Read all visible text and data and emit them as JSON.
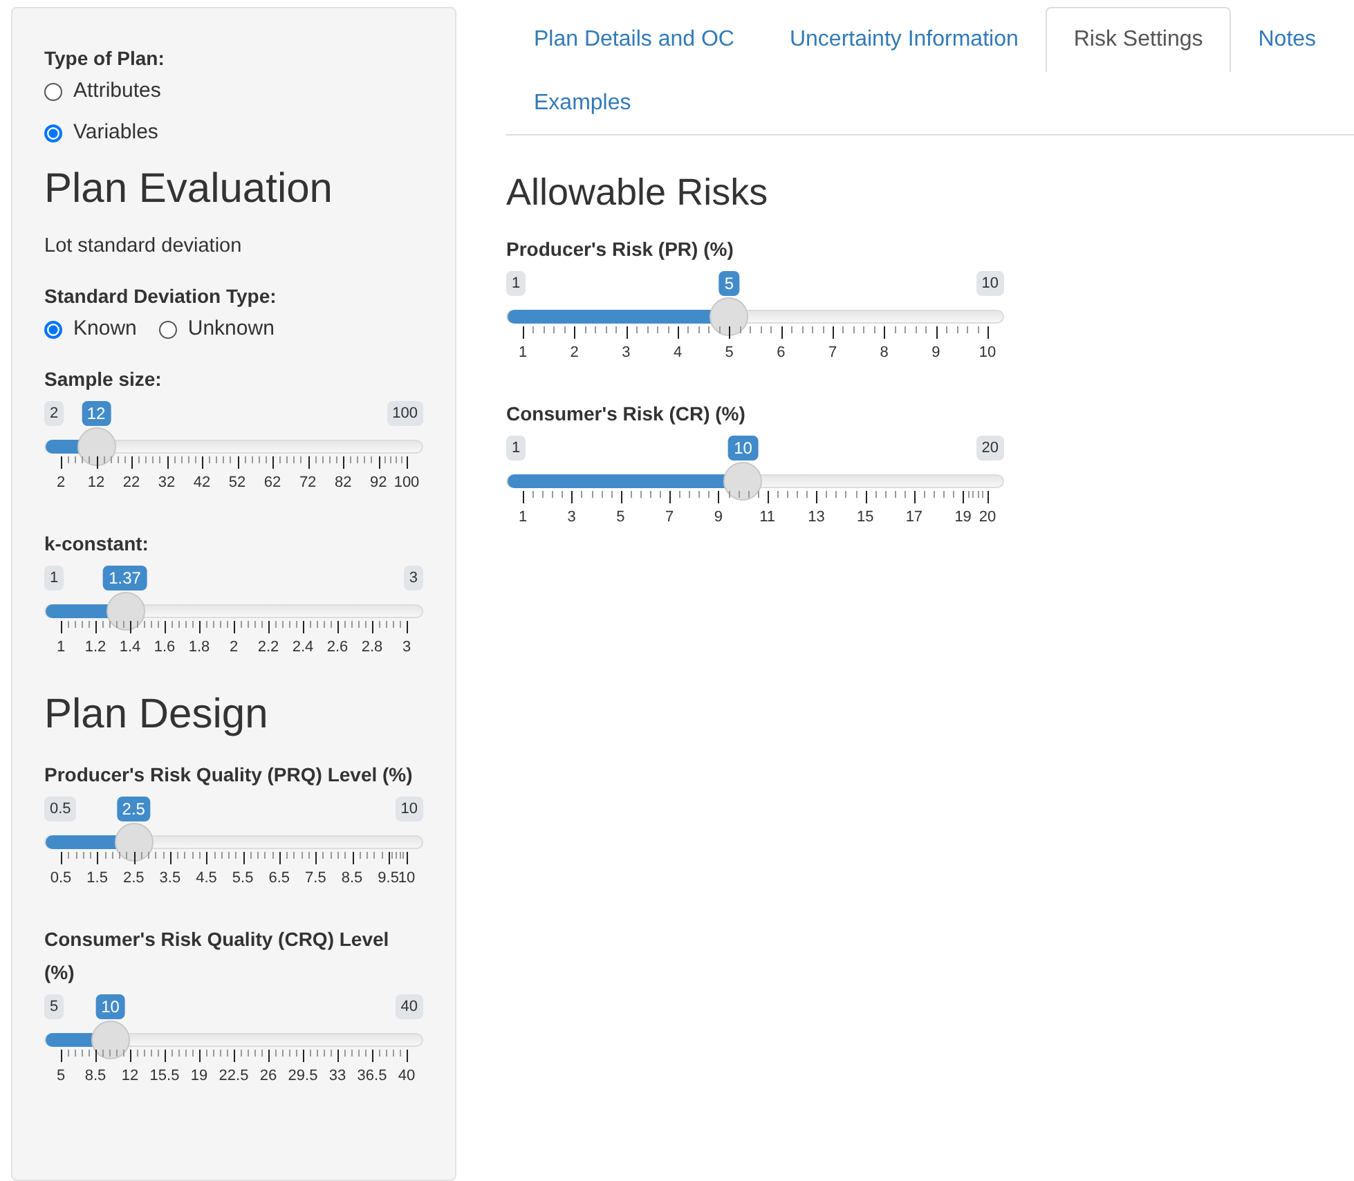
{
  "sidebar": {
    "items": [
      {
        "kind": "radio_stacked",
        "label": "Type of Plan:",
        "options": [
          {
            "label": "Attributes",
            "selected": false
          },
          {
            "label": "Variables",
            "selected": true
          }
        ]
      },
      {
        "kind": "heading",
        "text": "Plan Evaluation"
      },
      {
        "kind": "text",
        "text": "Lot standard deviation"
      },
      {
        "kind": "radio_inline",
        "label": "Standard Deviation Type:",
        "options": [
          {
            "label": "Known",
            "selected": true
          },
          {
            "label": "Unknown",
            "selected": false
          }
        ]
      },
      {
        "kind": "slider",
        "label": "Sample size:",
        "min": "2",
        "max": "100",
        "value": "12",
        "level": 0.102,
        "ticks": [
          "2",
          "12",
          "22",
          "32",
          "42",
          "52",
          "62",
          "72",
          "82",
          "92",
          "100"
        ]
      },
      {
        "kind": "slider",
        "label": "k-constant:",
        "min": "1",
        "max": "3",
        "value": "1.37",
        "level": 0.185,
        "ticks": [
          "1",
          "1.2",
          "1.4",
          "1.6",
          "1.8",
          "2",
          "2.2",
          "2.4",
          "2.6",
          "2.8",
          "3"
        ]
      },
      {
        "kind": "heading",
        "text": "Plan Design"
      },
      {
        "kind": "slider",
        "label": "Producer's Risk Quality (PRQ) Level (%)",
        "min": "0.5",
        "max": "10",
        "value": "2.5",
        "level": 0.2105,
        "ticks": [
          "0.5",
          "1.5",
          "2.5",
          "3.5",
          "4.5",
          "5.5",
          "6.5",
          "7.5",
          "8.5",
          "9.5",
          "10"
        ]
      },
      {
        "kind": "slider",
        "label": "Consumer's Risk Quality (CRQ) Level (%)",
        "min": "5",
        "max": "40",
        "value": "10",
        "level": 0.143,
        "ticks": [
          "5",
          "8.5",
          "12",
          "15.5",
          "19",
          "22.5",
          "26",
          "29.5",
          "33",
          "36.5",
          "40"
        ]
      }
    ]
  },
  "tabs": [
    {
      "label": "Plan Details and OC",
      "selected": false
    },
    {
      "label": "Uncertainty Information",
      "selected": false
    },
    {
      "label": "Risk Settings",
      "selected": true
    },
    {
      "label": "Notes",
      "selected": false
    },
    {
      "label": "Examples",
      "selected": false
    }
  ],
  "main": {
    "heading": "Allowable Risks",
    "sliders": [
      {
        "label": "Producer's Risk (PR) (%)",
        "min": "1",
        "max": "10",
        "value": "5",
        "level": 0.444,
        "ticks": [
          "1",
          "2",
          "3",
          "4",
          "5",
          "6",
          "7",
          "8",
          "9",
          "10"
        ]
      },
      {
        "label": "Consumer's Risk (CR) (%)",
        "min": "1",
        "max": "20",
        "value": "10",
        "level": 0.474,
        "ticks": [
          "1",
          "3",
          "5",
          "7",
          "9",
          "11",
          "13",
          "15",
          "17",
          "19",
          "20"
        ]
      }
    ]
  }
}
